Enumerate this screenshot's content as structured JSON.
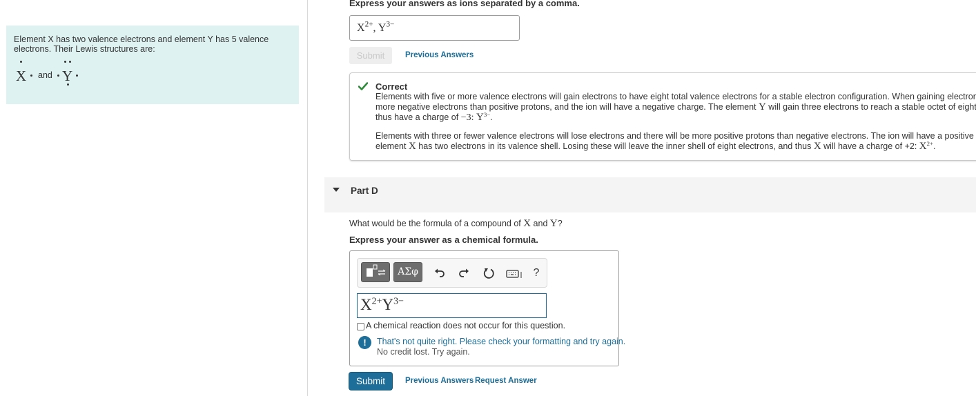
{
  "left_panel": {
    "info_text": "Element X has two valence electrons and element Y has 5 valence electrons. Their Lewis structures are:",
    "lewis_x": "X",
    "lewis_and": "and",
    "lewis_y": "Y"
  },
  "part_c": {
    "instruction": "Express your answers as ions separated by a comma.",
    "answer": {
      "x": "X",
      "x_charge": "2+",
      "sep": ",",
      "y": "Y",
      "y_charge": "3−"
    },
    "submit_label": "Submit",
    "previous_answers_label": "Previous Answers",
    "feedback": {
      "title": "Correct",
      "p1_line1_a": "Elements with five or more valence electrons will gain electrons to have eight total valence electrons for a stable electron configuration. When gaining electrons, there wi",
      "p1_line2_a": "more negative electrons than positive protons, and the ion will have a negative charge. The element ",
      "p1_line2_y": "Y",
      "p1_line2_b": " will gain three electrons to reach a stable octet of eight electrons,",
      "p1_line3_a": "thus have a charge of ",
      "p1_line3_val": "−3: ",
      "p1_line3_y": "Y",
      "p1_line3_charge": "3−",
      "p1_line3_end": ".",
      "p2_line1": "Elements with three or fewer valence electrons will lose electrons and there will be more positive protons than negative electrons. The ion will have a positive charge. Th",
      "p2_line2_a": "element ",
      "p2_line2_x": "X",
      "p2_line2_b": " has two electrons in its valence shell. Losing these will leave the inner shell of eight electrons, and thus ",
      "p2_line2_x2": "X",
      "p2_line2_c": " will have a charge of +2: ",
      "p2_line2_x3": "X",
      "p2_line2_charge": "2+",
      "p2_line2_end": "."
    }
  },
  "part_d": {
    "title": "Part D",
    "question_a": "What would be the formula of a compound of ",
    "question_x": "X",
    "question_and": " and ",
    "question_y": "Y",
    "question_end": "?",
    "instruction": "Express your answer as a chemical formula.",
    "toolbar": {
      "symbols_label": "ΑΣφ",
      "help_label": "?"
    },
    "formula": {
      "x": "X",
      "x_charge": "2+",
      "y": "Y",
      "y_charge": "3−"
    },
    "no_reaction_label": "A chemical reaction does not occur for this question.",
    "warning_text": "That's not quite right. Please check your formatting and try again.",
    "warning_sub": "No credit lost. Try again.",
    "submit_label": "Submit",
    "previous_answers_label": "Previous Answers",
    "request_answer_label": "Request Answer"
  },
  "colors": {
    "accent": "#1d6e98",
    "correct": "#2e8b3a",
    "info_bg": "#dff2f2"
  }
}
